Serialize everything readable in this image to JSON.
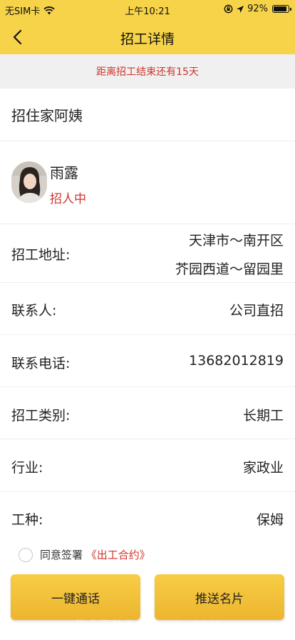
{
  "status_bar": {
    "carrier": "无SIM卡",
    "time": "上午10:21",
    "battery": "92%"
  },
  "nav": {
    "title": "招工详情"
  },
  "countdown": "距离招工结束还有15天",
  "job_title": "招住家阿姨",
  "poster": {
    "name": "雨露",
    "status": "招人中"
  },
  "details": {
    "address_label": "招工地址:",
    "address_line1": "天津市～南开区",
    "address_line2": "芥园西道～留园里",
    "contact_label": "联系人:",
    "contact_value": "公司直招",
    "phone_label": "联系电话:",
    "phone_value": "13682012819",
    "category_label": "招工类别:",
    "category_value": "长期工",
    "industry_label": "行业:",
    "industry_value": "家政业",
    "worktype_label": "工种:",
    "worktype_value": "保姆"
  },
  "agreement": {
    "text": "同意签署",
    "link": "《出工合约》"
  },
  "buttons": {
    "call": "一键通话",
    "share": "推送名片"
  },
  "watermark": "指尖汇软件 • ZJHRJ.COM",
  "colors": {
    "header": "#f6d349",
    "accent_red": "#d0342c",
    "button": "#efbb35"
  }
}
